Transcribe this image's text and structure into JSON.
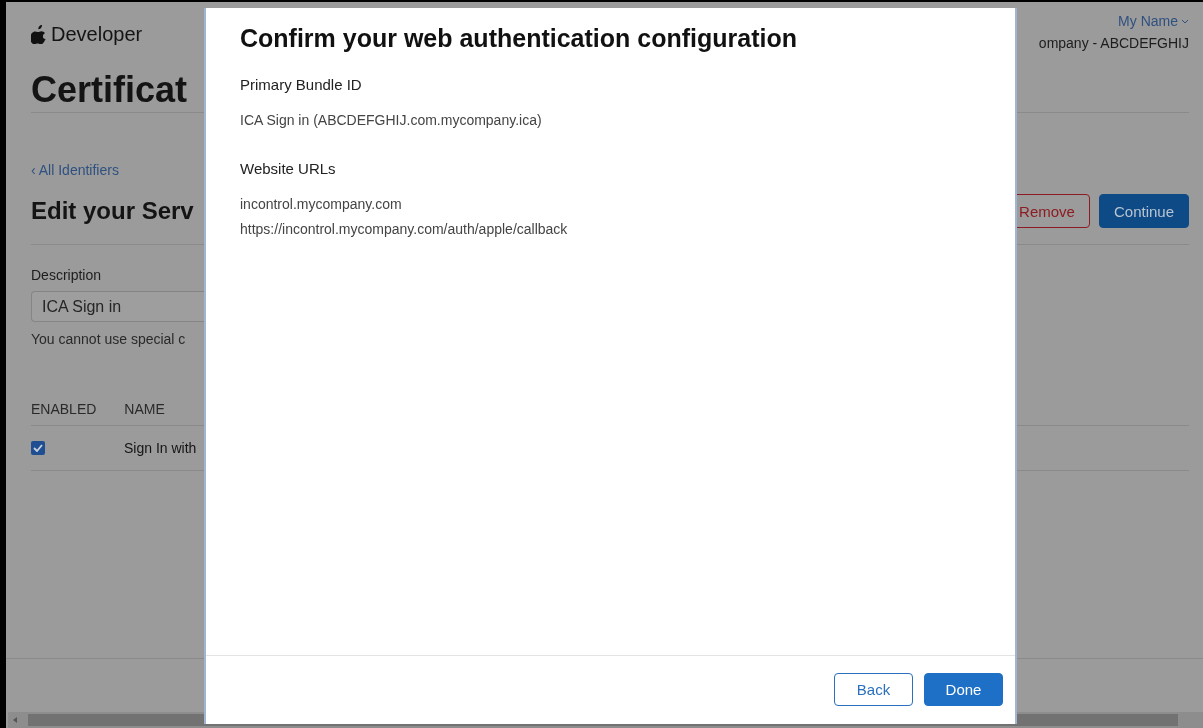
{
  "background_page": {
    "logo_text": "Developer",
    "account": {
      "name": "My Name",
      "team": "ompany - ABCDEFGHIJ"
    },
    "page_title": "Certificat",
    "back_link": "‹ All Identifiers",
    "heading": "Edit your Serv",
    "buttons": [
      {
        "label": "Remove",
        "kind": "destructive"
      },
      {
        "label": "Continue",
        "kind": "primary"
      }
    ],
    "description": {
      "label": "Description",
      "value": "ICA Sign in",
      "hint": "You cannot use special c"
    },
    "capabilities": {
      "columns": [
        "ENABLED",
        "NAME"
      ],
      "rows": [
        {
          "enabled": true,
          "name": "Sign In with"
        }
      ]
    }
  },
  "dialog": {
    "title": "Confirm your web authentication configuration",
    "sections": [
      {
        "heading": "Primary Bundle ID",
        "lines": [
          "ICA Sign in (ABCDEFGHIJ.com.mycompany.ica)"
        ]
      },
      {
        "heading": "Website URLs",
        "lines": [
          "incontrol.mycompany.com",
          "https://incontrol.mycompany.com/auth/apple/callback"
        ]
      }
    ],
    "buttons": [
      {
        "label": "Back",
        "kind": "secondary"
      },
      {
        "label": "Done",
        "kind": "primary"
      }
    ]
  }
}
